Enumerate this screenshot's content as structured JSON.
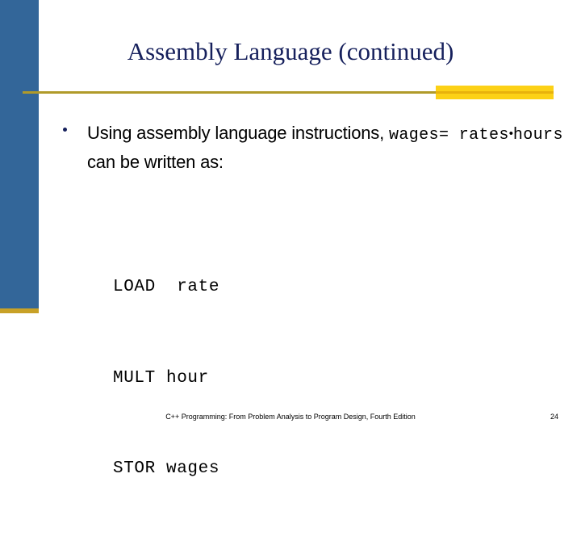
{
  "slide": {
    "title": "Assembly Language (continued)",
    "colors": {
      "sidebar_blue": "#336699",
      "sidebar_gold": "#c8a127",
      "rule_thin": "#b09a2a",
      "rule_block": "#fcd116",
      "title_navy": "#16205c",
      "body_black": "#000000"
    }
  },
  "body": {
    "bullet": {
      "marker": "bullet-dot",
      "line1_prefix": "Using assembly language instructions, ",
      "line1_code": "wages",
      "line2_code_a": "= rates",
      "line2_operator": "•",
      "line2_code_b": "hours",
      "line2_suffix": " can be written as:"
    },
    "code_block": {
      "lines": [
        "LOAD  rate",
        "MULT hour",
        "STOR wages"
      ]
    }
  },
  "footer": {
    "text": "C++ Programming: From Problem Analysis to Program Design, Fourth Edition",
    "page_number": "24"
  }
}
